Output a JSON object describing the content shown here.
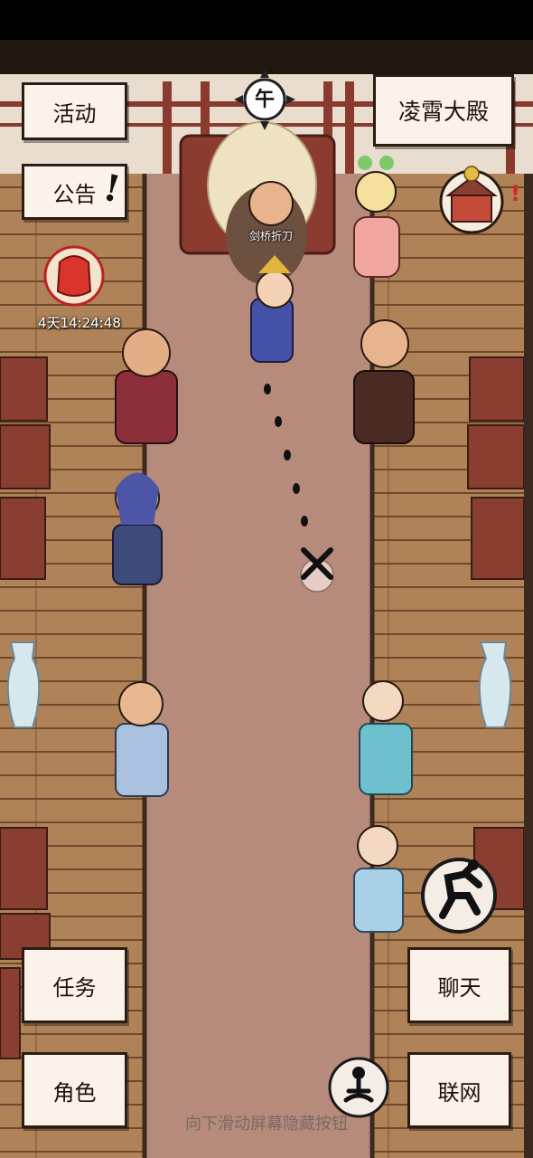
{
  "buttons": {
    "activity": "活动",
    "notice": "公告",
    "location": "凌霄大殿",
    "task": "任务",
    "role": "角色",
    "chat": "聊天",
    "network": "联网"
  },
  "time_of_day": "午",
  "event_timer": "4天14:24:48",
  "character_label": "剑桥折刀",
  "hint": "向下滑动屏幕隐藏按钮",
  "icons": [
    "red-bag-icon",
    "shop-icon",
    "run-icon",
    "meditate-icon",
    "sun-icon",
    "move-target-icon"
  ],
  "colors": {
    "floor": "#a67c55",
    "carpet": "#b58a7c",
    "paper": "#fbf3ea",
    "ink": "#2b1d14"
  }
}
